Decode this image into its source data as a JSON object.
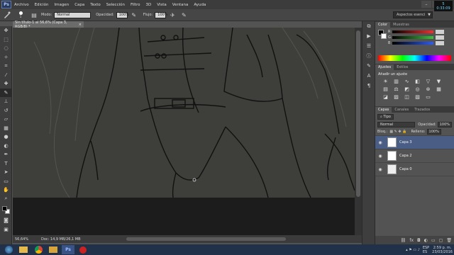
{
  "app": {
    "logo": "Ps"
  },
  "menu": [
    "Archivo",
    "Edición",
    "Imagen",
    "Capa",
    "Texto",
    "Selección",
    "Filtro",
    "3D",
    "Vista",
    "Ventana",
    "Ayuda"
  ],
  "window_controls": [
    "minimize-icon",
    "maximize-icon",
    "close-icon"
  ],
  "options": {
    "mode_label": "Modo:",
    "mode_value": "Normal",
    "opacity_label": "Opacidad:",
    "opacity_value": "100%",
    "flow_label": "Flujo:",
    "flow_value": "100%",
    "brush_size": "1",
    "workspace": "Aspectos esenci",
    "clock_top": "5",
    "clock_bottom": "0:33:09"
  },
  "document": {
    "tab_title": "Sin título-1 al 56,6% (Capa 3, RGB/8) *",
    "zoom": "56,64%",
    "doc_info": "Doc: 14,9 MB/26,1 MB"
  },
  "tools": [
    "move-icon",
    "marquee-icon",
    "lasso-icon",
    "quick-select-icon",
    "crop-icon",
    "eyedropper-icon",
    "healing-icon",
    "brush-icon",
    "stamp-icon",
    "history-brush-icon",
    "eraser-icon",
    "gradient-icon",
    "blur-icon",
    "dodge-icon",
    "pen-icon",
    "type-icon",
    "path-select-icon",
    "shape-icon",
    "hand-icon",
    "zoom-icon",
    "foreground-color",
    "quickmask-icon",
    "screen-mode-icon"
  ],
  "color_panel": {
    "tabs": [
      "Color",
      "Muestras"
    ],
    "sliders": [
      {
        "label": "R",
        "value": "",
        "color": "#ff2a2a"
      },
      {
        "label": "G",
        "value": "",
        "color": "#38c438"
      },
      {
        "label": "B",
        "value": "",
        "color": "#2a5cff"
      }
    ]
  },
  "adjustments": {
    "tabs": [
      "Ajustes",
      "Estilos"
    ],
    "title": "Añadir un ajuste",
    "icons": [
      "brightness-icon",
      "levels-icon",
      "curves-icon",
      "exposure-icon",
      "vibrance-icon",
      "triangle-icon",
      "hue-icon",
      "color-balance-icon",
      "bw-icon",
      "photo-filter-icon",
      "channel-mixer-icon",
      "lookup-icon",
      "invert-icon",
      "posterize-icon",
      "threshold-icon",
      "selective-color-icon",
      "gradient-map-icon"
    ]
  },
  "layers": {
    "tabs": [
      "Capas",
      "Canales",
      "Trazados"
    ],
    "kind": "Tipo",
    "blend": "Normal",
    "opacity_label": "Opacidad:",
    "opacity_value": "100%",
    "lock_label": "Bloq.:",
    "fill_label": "Relleno:",
    "fill_value": "100%",
    "items": [
      {
        "name": "Capa 3",
        "selected": true,
        "thumb": "sketch"
      },
      {
        "name": "Capa 2",
        "selected": false,
        "thumb": "sketch"
      },
      {
        "name": "Capa 0",
        "selected": false,
        "thumb": "blank"
      }
    ]
  },
  "taskbar": {
    "apps": [
      "windows-start-icon",
      "explorer-icon",
      "chrome-icon",
      "folder-icon",
      "photoshop-icon",
      "record-icon"
    ],
    "language": "ESP",
    "locale": "ES",
    "time": "2:59 p. m.",
    "date": "23/03/2016"
  }
}
